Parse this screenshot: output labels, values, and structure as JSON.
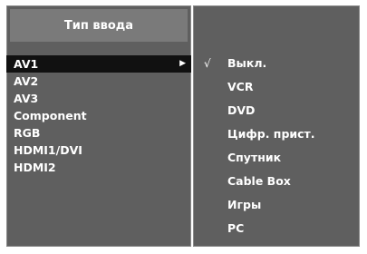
{
  "menu": {
    "title": "Тип ввода",
    "inputs": [
      "AV1",
      "AV2",
      "AV3",
      "Component",
      "RGB",
      "HDMI1/DVI",
      "HDMI2"
    ],
    "selected_input": "AV1",
    "labels": [
      "Выкл.",
      "VCR",
      "DVD",
      "Цифр. прист.",
      "Спутник",
      "Cable Box",
      "Игры",
      "PC"
    ],
    "checked_label": "Выкл."
  },
  "icons": {
    "arrow": "triangle-right-icon",
    "check": "checkmark-icon"
  },
  "colors": {
    "panel": "#5f5f5f",
    "header": "#7a7a7a",
    "selected_row": "#111111",
    "text": "#ffffff"
  }
}
